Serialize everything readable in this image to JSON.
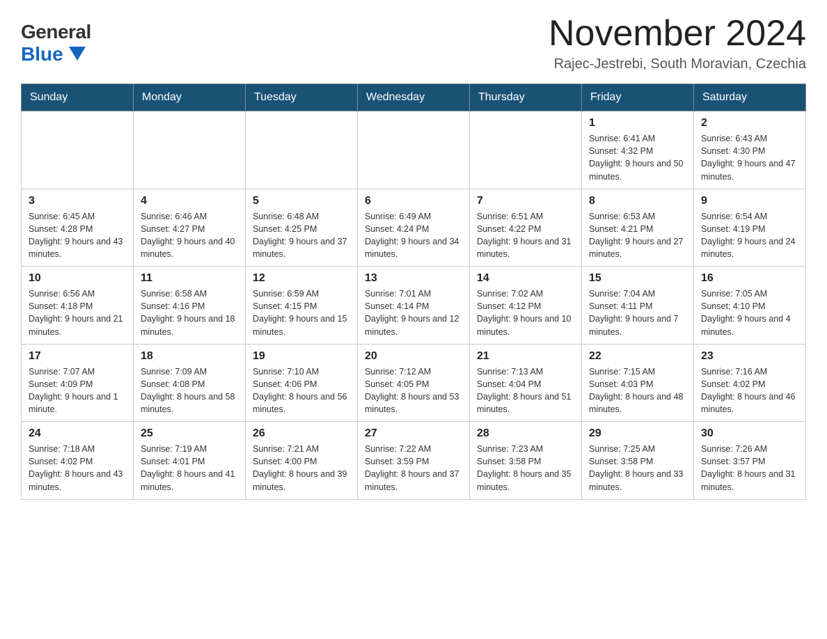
{
  "header": {
    "logo_general": "General",
    "logo_blue": "Blue",
    "month_year": "November 2024",
    "location": "Rajec-Jestrebi, South Moravian, Czechia"
  },
  "weekdays": [
    "Sunday",
    "Monday",
    "Tuesday",
    "Wednesday",
    "Thursday",
    "Friday",
    "Saturday"
  ],
  "weeks": [
    [
      {
        "day": "",
        "sunrise": "",
        "sunset": "",
        "daylight": ""
      },
      {
        "day": "",
        "sunrise": "",
        "sunset": "",
        "daylight": ""
      },
      {
        "day": "",
        "sunrise": "",
        "sunset": "",
        "daylight": ""
      },
      {
        "day": "",
        "sunrise": "",
        "sunset": "",
        "daylight": ""
      },
      {
        "day": "",
        "sunrise": "",
        "sunset": "",
        "daylight": ""
      },
      {
        "day": "1",
        "sunrise": "Sunrise: 6:41 AM",
        "sunset": "Sunset: 4:32 PM",
        "daylight": "Daylight: 9 hours and 50 minutes."
      },
      {
        "day": "2",
        "sunrise": "Sunrise: 6:43 AM",
        "sunset": "Sunset: 4:30 PM",
        "daylight": "Daylight: 9 hours and 47 minutes."
      }
    ],
    [
      {
        "day": "3",
        "sunrise": "Sunrise: 6:45 AM",
        "sunset": "Sunset: 4:28 PM",
        "daylight": "Daylight: 9 hours and 43 minutes."
      },
      {
        "day": "4",
        "sunrise": "Sunrise: 6:46 AM",
        "sunset": "Sunset: 4:27 PM",
        "daylight": "Daylight: 9 hours and 40 minutes."
      },
      {
        "day": "5",
        "sunrise": "Sunrise: 6:48 AM",
        "sunset": "Sunset: 4:25 PM",
        "daylight": "Daylight: 9 hours and 37 minutes."
      },
      {
        "day": "6",
        "sunrise": "Sunrise: 6:49 AM",
        "sunset": "Sunset: 4:24 PM",
        "daylight": "Daylight: 9 hours and 34 minutes."
      },
      {
        "day": "7",
        "sunrise": "Sunrise: 6:51 AM",
        "sunset": "Sunset: 4:22 PM",
        "daylight": "Daylight: 9 hours and 31 minutes."
      },
      {
        "day": "8",
        "sunrise": "Sunrise: 6:53 AM",
        "sunset": "Sunset: 4:21 PM",
        "daylight": "Daylight: 9 hours and 27 minutes."
      },
      {
        "day": "9",
        "sunrise": "Sunrise: 6:54 AM",
        "sunset": "Sunset: 4:19 PM",
        "daylight": "Daylight: 9 hours and 24 minutes."
      }
    ],
    [
      {
        "day": "10",
        "sunrise": "Sunrise: 6:56 AM",
        "sunset": "Sunset: 4:18 PM",
        "daylight": "Daylight: 9 hours and 21 minutes."
      },
      {
        "day": "11",
        "sunrise": "Sunrise: 6:58 AM",
        "sunset": "Sunset: 4:16 PM",
        "daylight": "Daylight: 9 hours and 18 minutes."
      },
      {
        "day": "12",
        "sunrise": "Sunrise: 6:59 AM",
        "sunset": "Sunset: 4:15 PM",
        "daylight": "Daylight: 9 hours and 15 minutes."
      },
      {
        "day": "13",
        "sunrise": "Sunrise: 7:01 AM",
        "sunset": "Sunset: 4:14 PM",
        "daylight": "Daylight: 9 hours and 12 minutes."
      },
      {
        "day": "14",
        "sunrise": "Sunrise: 7:02 AM",
        "sunset": "Sunset: 4:12 PM",
        "daylight": "Daylight: 9 hours and 10 minutes."
      },
      {
        "day": "15",
        "sunrise": "Sunrise: 7:04 AM",
        "sunset": "Sunset: 4:11 PM",
        "daylight": "Daylight: 9 hours and 7 minutes."
      },
      {
        "day": "16",
        "sunrise": "Sunrise: 7:05 AM",
        "sunset": "Sunset: 4:10 PM",
        "daylight": "Daylight: 9 hours and 4 minutes."
      }
    ],
    [
      {
        "day": "17",
        "sunrise": "Sunrise: 7:07 AM",
        "sunset": "Sunset: 4:09 PM",
        "daylight": "Daylight: 9 hours and 1 minute."
      },
      {
        "day": "18",
        "sunrise": "Sunrise: 7:09 AM",
        "sunset": "Sunset: 4:08 PM",
        "daylight": "Daylight: 8 hours and 58 minutes."
      },
      {
        "day": "19",
        "sunrise": "Sunrise: 7:10 AM",
        "sunset": "Sunset: 4:06 PM",
        "daylight": "Daylight: 8 hours and 56 minutes."
      },
      {
        "day": "20",
        "sunrise": "Sunrise: 7:12 AM",
        "sunset": "Sunset: 4:05 PM",
        "daylight": "Daylight: 8 hours and 53 minutes."
      },
      {
        "day": "21",
        "sunrise": "Sunrise: 7:13 AM",
        "sunset": "Sunset: 4:04 PM",
        "daylight": "Daylight: 8 hours and 51 minutes."
      },
      {
        "day": "22",
        "sunrise": "Sunrise: 7:15 AM",
        "sunset": "Sunset: 4:03 PM",
        "daylight": "Daylight: 8 hours and 48 minutes."
      },
      {
        "day": "23",
        "sunrise": "Sunrise: 7:16 AM",
        "sunset": "Sunset: 4:02 PM",
        "daylight": "Daylight: 8 hours and 46 minutes."
      }
    ],
    [
      {
        "day": "24",
        "sunrise": "Sunrise: 7:18 AM",
        "sunset": "Sunset: 4:02 PM",
        "daylight": "Daylight: 8 hours and 43 minutes."
      },
      {
        "day": "25",
        "sunrise": "Sunrise: 7:19 AM",
        "sunset": "Sunset: 4:01 PM",
        "daylight": "Daylight: 8 hours and 41 minutes."
      },
      {
        "day": "26",
        "sunrise": "Sunrise: 7:21 AM",
        "sunset": "Sunset: 4:00 PM",
        "daylight": "Daylight: 8 hours and 39 minutes."
      },
      {
        "day": "27",
        "sunrise": "Sunrise: 7:22 AM",
        "sunset": "Sunset: 3:59 PM",
        "daylight": "Daylight: 8 hours and 37 minutes."
      },
      {
        "day": "28",
        "sunrise": "Sunrise: 7:23 AM",
        "sunset": "Sunset: 3:58 PM",
        "daylight": "Daylight: 8 hours and 35 minutes."
      },
      {
        "day": "29",
        "sunrise": "Sunrise: 7:25 AM",
        "sunset": "Sunset: 3:58 PM",
        "daylight": "Daylight: 8 hours and 33 minutes."
      },
      {
        "day": "30",
        "sunrise": "Sunrise: 7:26 AM",
        "sunset": "Sunset: 3:57 PM",
        "daylight": "Daylight: 8 hours and 31 minutes."
      }
    ]
  ]
}
